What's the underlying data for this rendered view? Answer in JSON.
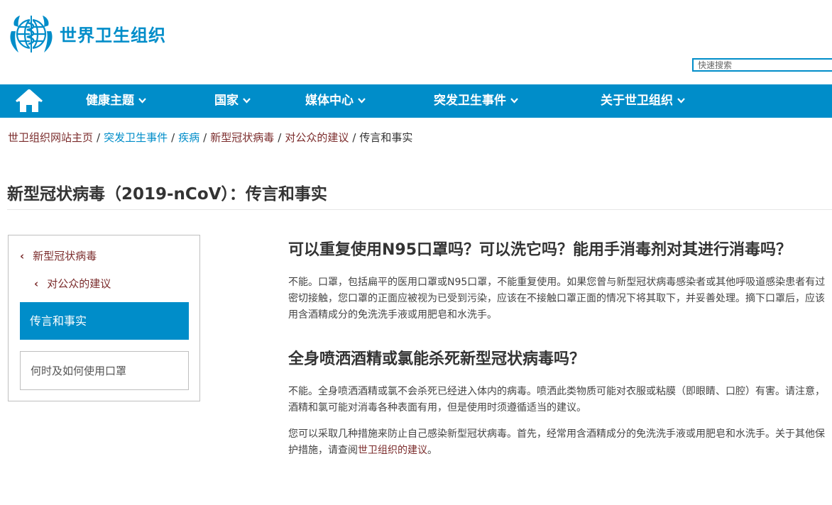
{
  "header": {
    "logo_text": "世界卫生组织",
    "search_placeholder": "快速搜索"
  },
  "nav": {
    "items": [
      {
        "label": "健康主题"
      },
      {
        "label": "国家"
      },
      {
        "label": "媒体中心"
      },
      {
        "label": "突发卫生事件"
      },
      {
        "label": "关于世卫组织"
      }
    ]
  },
  "breadcrumb": {
    "items": [
      "世卫组织网站主页",
      "突发卫生事件",
      "疾病",
      "新型冠状病毒",
      "对公众的建议"
    ],
    "current": "传言和事实",
    "separator": "/"
  },
  "page": {
    "title": "新型冠状病毒（2019-nCoV）：传言和事实"
  },
  "sidebar": {
    "parent": "新型冠状病毒",
    "child": "对公众的建议",
    "active": "传言和事实",
    "other": "何时及如何使用口罩"
  },
  "content": {
    "q1": "可以重复使用N95口罩吗？可以洗它吗？能用手消毒剂对其进行消毒吗？",
    "a1": "不能。口罩，包括扁平的医用口罩或N95口罩，不能重复使用。如果您曾与新型冠状病毒感染者或其他呼吸道感染患者有过密切接触，您口罩的正面应被视为已受到污染，应该在不接触口罩正面的情况下将其取下，并妥善处理。摘下口罩后，应该用含酒精成分的免洗洗手液或用肥皂和水洗手。",
    "q2": "全身喷洒酒精或氯能杀死新型冠状病毒吗？",
    "a2": "不能。全身喷洒酒精或氯不会杀死已经进入体内的病毒。喷洒此类物质可能对衣服或粘膜（即眼睛、口腔）有害。请注意，酒精和氯可能对消毒各种表面有用，但是使用时须遵循适当的建议。",
    "a3_before": "您可以采取几种措施来防止自己感染新型冠状病毒。首先，经常用含酒精成分的免洗洗手液或用肥皂和水洗手。关于其他保护措施，请查阅",
    "a3_link": "世卫组织的建议",
    "a3_after": "。"
  },
  "colors": {
    "brand_blue": "#008dc9",
    "link_maroon": "#7b2c2c"
  }
}
